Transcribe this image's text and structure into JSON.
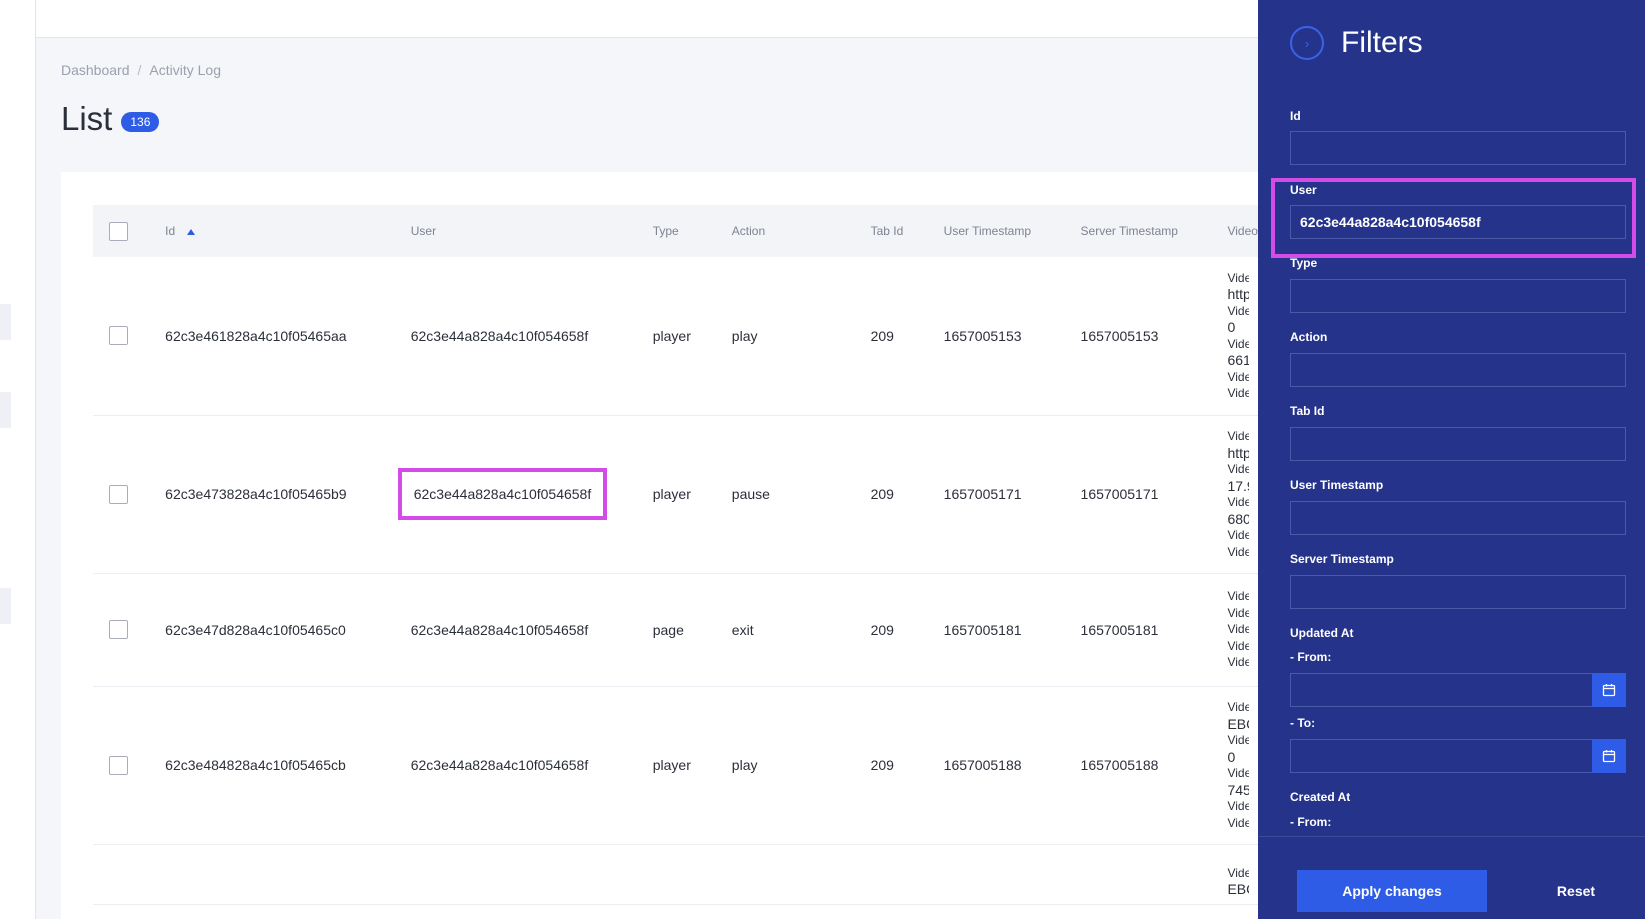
{
  "breadcrumb": {
    "home": "Dashboard",
    "sep": "/",
    "current": "Activity Log"
  },
  "page": {
    "title": "List",
    "count": "136"
  },
  "table": {
    "headers": {
      "id": "Id",
      "user": "User",
      "type": "Type",
      "action": "Action",
      "tab_id": "Tab Id",
      "user_timestamp": "User Timestamp",
      "server_timestamp": "Server Timestamp",
      "video": "Video"
    },
    "rows": [
      {
        "id": "62c3e461828a4c10f05465aa",
        "user": "62c3e44a828a4c10f054658f",
        "type": "player",
        "action": "play",
        "tab_id": "209",
        "user_timestamp": "1657005153",
        "server_timestamp": "1657005153",
        "video": [
          "Vide",
          "http",
          "Vide",
          "0",
          "Vide",
          "661",
          "Vide",
          "Vide"
        ]
      },
      {
        "id": "62c3e473828a4c10f05465b9",
        "user": "62c3e44a828a4c10f054658f",
        "type": "player",
        "action": "pause",
        "tab_id": "209",
        "user_timestamp": "1657005171",
        "server_timestamp": "1657005171",
        "video": [
          "Vide",
          "http",
          "Vide",
          "17.9",
          "Vide",
          "680",
          "Vide",
          "Vide"
        ]
      },
      {
        "id": "62c3e47d828a4c10f05465c0",
        "user": "62c3e44a828a4c10f054658f",
        "type": "page",
        "action": "exit",
        "tab_id": "209",
        "user_timestamp": "1657005181",
        "server_timestamp": "1657005181",
        "video": [
          "Vide",
          "Vide",
          "Vide",
          "Vide",
          "Vide"
        ]
      },
      {
        "id": "62c3e484828a4c10f05465cb",
        "user": "62c3e44a828a4c10f054658f",
        "type": "player",
        "action": "play",
        "tab_id": "209",
        "user_timestamp": "1657005188",
        "server_timestamp": "1657005188",
        "video": [
          "Vide",
          "EBC",
          "Vide",
          "0",
          "Vide",
          "745",
          "Vide",
          "Vide"
        ]
      },
      {
        "id": "",
        "user": "",
        "type": "",
        "action": "",
        "tab_id": "",
        "user_timestamp": "",
        "server_timestamp": "",
        "video": [
          "Vide",
          "EBC"
        ]
      }
    ]
  },
  "filters": {
    "title": "Filters",
    "id_label": "Id",
    "id_value": "",
    "user_label": "User",
    "user_value": "62c3e44a828a4c10f054658f",
    "type_label": "Type",
    "type_value": "",
    "action_label": "Action",
    "action_value": "",
    "tab_id_label": "Tab Id",
    "tab_id_value": "",
    "user_ts_label": "User Timestamp",
    "user_ts_value": "",
    "server_ts_label": "Server Timestamp",
    "server_ts_value": "",
    "updated_at_label": "Updated At",
    "from_label": "- From:",
    "to_label": "- To:",
    "created_at_label": "Created At",
    "apply_label": "Apply changes",
    "reset_label": "Reset"
  },
  "colors": {
    "accent": "#2f5ce6",
    "panel": "#25348a",
    "highlight": "#d34ce8"
  }
}
